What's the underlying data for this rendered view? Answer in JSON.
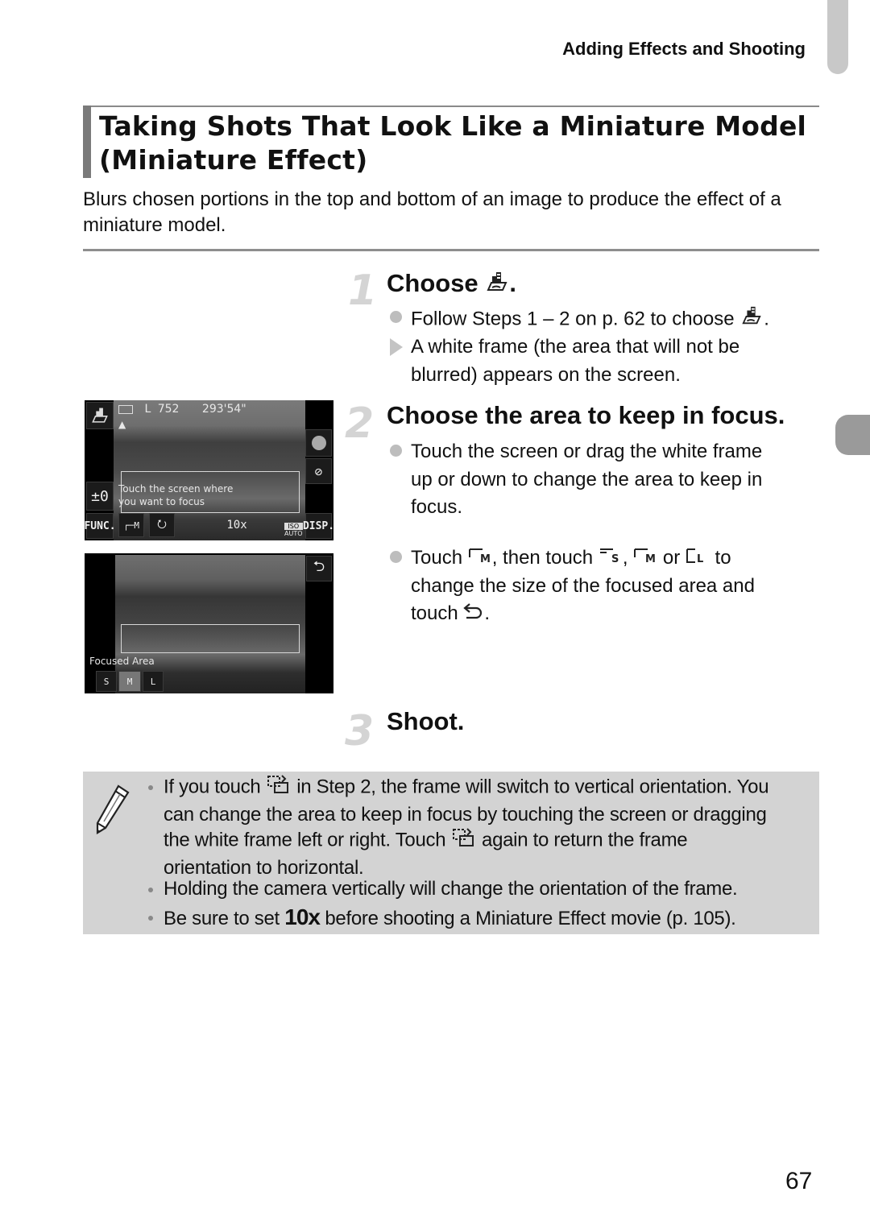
{
  "header": {
    "running_head": "Adding Effects and Shooting"
  },
  "title": {
    "line1": "Taking Shots That Look Like a Miniature Model",
    "line2": "(Miniature Effect)"
  },
  "intro": "Blurs chosen portions in the top and bottom of an image to produce the effect of a miniature model.",
  "steps": [
    {
      "number": "1",
      "title": "Choose",
      "title_icon": "miniature-mode-icon",
      "title_suffix": ".",
      "bullets": [
        {
          "type": "action",
          "text_before": "Follow Steps 1 – 2 on p. 62 to choose",
          "icon": "miniature-mode-icon",
          "text_after": "."
        },
        {
          "type": "result",
          "line1": "A white frame (the area that will not be",
          "line2": "blurred) appears on the screen."
        }
      ]
    },
    {
      "number": "2",
      "title": "Choose the area to keep in focus.",
      "bullets": [
        {
          "type": "action",
          "lines": [
            "Touch the screen or drag the white frame",
            "up or down to change the area to keep in",
            "focus."
          ]
        },
        {
          "type": "action",
          "parts": [
            "Touch",
            ", then touch",
            ",",
            "or",
            "to"
          ],
          "icons": [
            "frame-size-m-icon",
            "frame-size-s-icon",
            "frame-size-m-icon",
            "frame-size-l-icon"
          ],
          "line2": "change the size of the focused area and",
          "line3_before": "touch",
          "line3_icon": "return-icon",
          "line3_after": "."
        }
      ]
    },
    {
      "number": "3",
      "title": "Shoot."
    }
  ],
  "screen1": {
    "battery": "battery-icon",
    "image_size": "L",
    "shots_remaining": "752",
    "movie_time": "293'54\"",
    "exposure": "±0",
    "hint_line1": "Touch the screen where",
    "hint_line2": "you want to focus",
    "func_label": "FUNC.",
    "size_label": "M",
    "zoom_label": "10x",
    "iso_label": "ISO",
    "iso_value": "AUTO",
    "disp_label": "DISP."
  },
  "screen2": {
    "label": "Focused Area",
    "options": [
      "S",
      "M",
      "L"
    ],
    "selected": "M"
  },
  "note": {
    "items": [
      {
        "lines": [
          [
            "If you touch",
            "rotate-frame-icon",
            "in Step 2, the frame will switch to vertical orientation. You"
          ],
          [
            "can change the area to keep in focus by touching the screen or dragging"
          ],
          [
            "the white frame left or right. Touch",
            "rotate-frame-icon",
            "again to return the frame"
          ],
          [
            "orientation to horizontal."
          ]
        ]
      },
      {
        "text": "Holding the camera vertically will change the orientation of the frame."
      },
      {
        "before": "Be sure to set",
        "emph": "10x",
        "after": "before shooting a Miniature Effect movie (p. 105)."
      }
    ]
  },
  "page_number": "67"
}
